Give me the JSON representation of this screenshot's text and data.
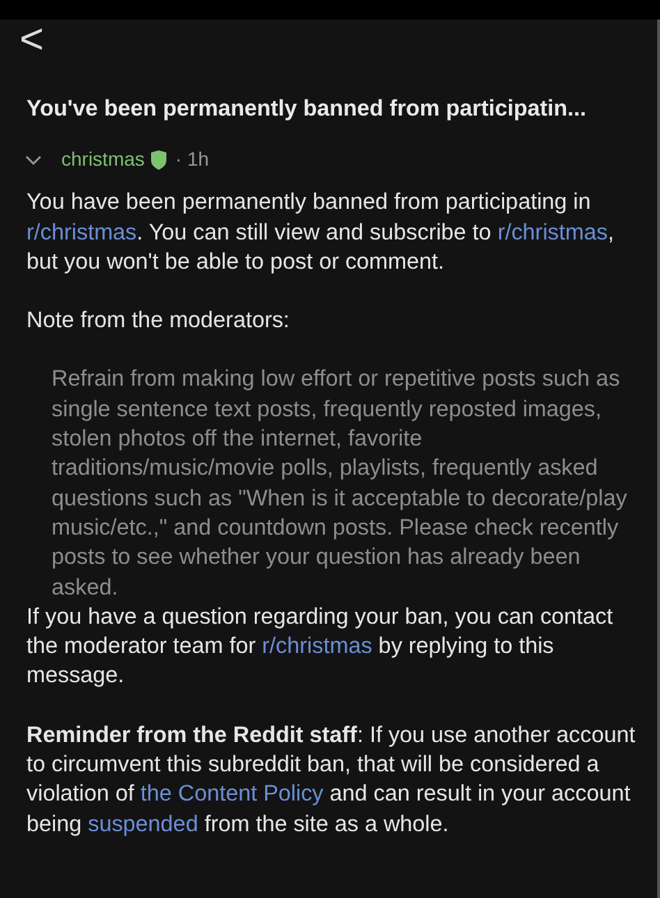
{
  "header": {
    "back": "<"
  },
  "message": {
    "title": "You've been permanently banned from participatin...",
    "subreddit": "christmas",
    "moderator": true,
    "time": "· 1h",
    "expanded": true,
    "body": [
      {
        "kind": "paragraph",
        "parts": [
          {
            "kind": "text",
            "text": "You have been permanently banned from participating in "
          },
          {
            "kind": "link",
            "text": "r/christmas"
          },
          {
            "kind": "text",
            "text": ". You can still view and subscribe to "
          },
          {
            "kind": "link",
            "text": "r/christmas"
          },
          {
            "kind": "text",
            "text": ", but you won't be able to post or comment."
          }
        ]
      },
      {
        "kind": "paragraph",
        "parts": [
          {
            "kind": "text",
            "text": "Note from the moderators:"
          }
        ]
      },
      {
        "kind": "quote",
        "parts": [
          {
            "kind": "text",
            "text": "Refrain from making low effort or repetitive posts such as single sentence text posts, frequently reposted images, stolen photos off the internet, favorite traditions/music/movie polls, playlists, frequently asked questions such as \"When is it acceptable to decorate/play music/etc.,\" and countdown posts. Please check recently posts to see whether your question has already been asked."
          }
        ]
      },
      {
        "kind": "tight",
        "parts": [
          {
            "kind": "text",
            "text": "If you have a question regarding your ban, you can contact the moderator team for "
          },
          {
            "kind": "link",
            "text": "r/christmas"
          },
          {
            "kind": "text",
            "text": " by replying to this message."
          }
        ]
      },
      {
        "kind": "paragraph",
        "parts": [
          {
            "kind": "bold",
            "text": "Reminder from the Reddit staff"
          },
          {
            "kind": "text",
            "text": ": If you use another account to circumvent this subreddit ban, that will be considered a violation of "
          },
          {
            "kind": "link",
            "text": "the Content Policy"
          },
          {
            "kind": "text",
            "text": " and can result in your account being "
          },
          {
            "kind": "link",
            "text": "suspended"
          },
          {
            "kind": "text",
            "text": " from the site as a whole."
          }
        ]
      }
    ]
  }
}
